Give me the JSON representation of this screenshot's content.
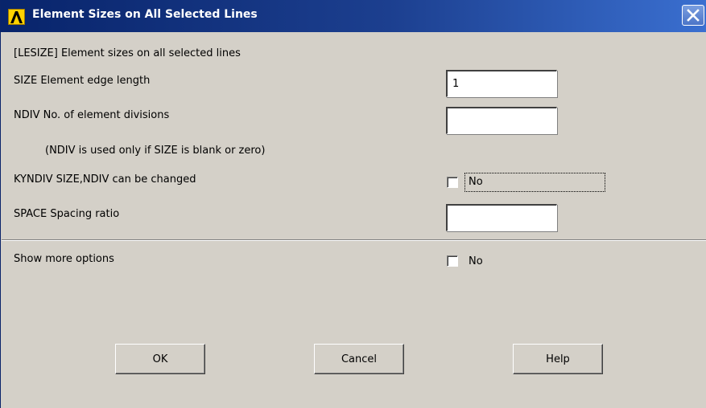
{
  "window": {
    "title": "Element Sizes on All Selected Lines"
  },
  "dialog": {
    "header": "[LESIZE]  Element sizes on all selected lines",
    "size": {
      "label": "SIZE    Element edge length",
      "value": "1"
    },
    "ndiv": {
      "label": "NDIV    No. of element divisions",
      "value": ""
    },
    "ndiv_note": "(NDIV is used only if SIZE is blank or zero)",
    "kyndiv": {
      "label": "KYNDIV  SIZE,NDIV can be changed",
      "checked": false,
      "state_text": "No"
    },
    "space": {
      "label": "SPACE   Spacing ratio",
      "value": ""
    },
    "more_options": {
      "label": "Show more options",
      "checked": false,
      "state_text": "No"
    }
  },
  "buttons": {
    "ok": "OK",
    "cancel": "Cancel",
    "help": "Help"
  },
  "colors": {
    "titlebar_start": "#08246b",
    "titlebar_end": "#3a6fd0",
    "face": "#d4d0c8",
    "logo": "#ffd200"
  },
  "icons": {
    "app": "ansys-logo-icon",
    "close": "close-x-icon"
  }
}
